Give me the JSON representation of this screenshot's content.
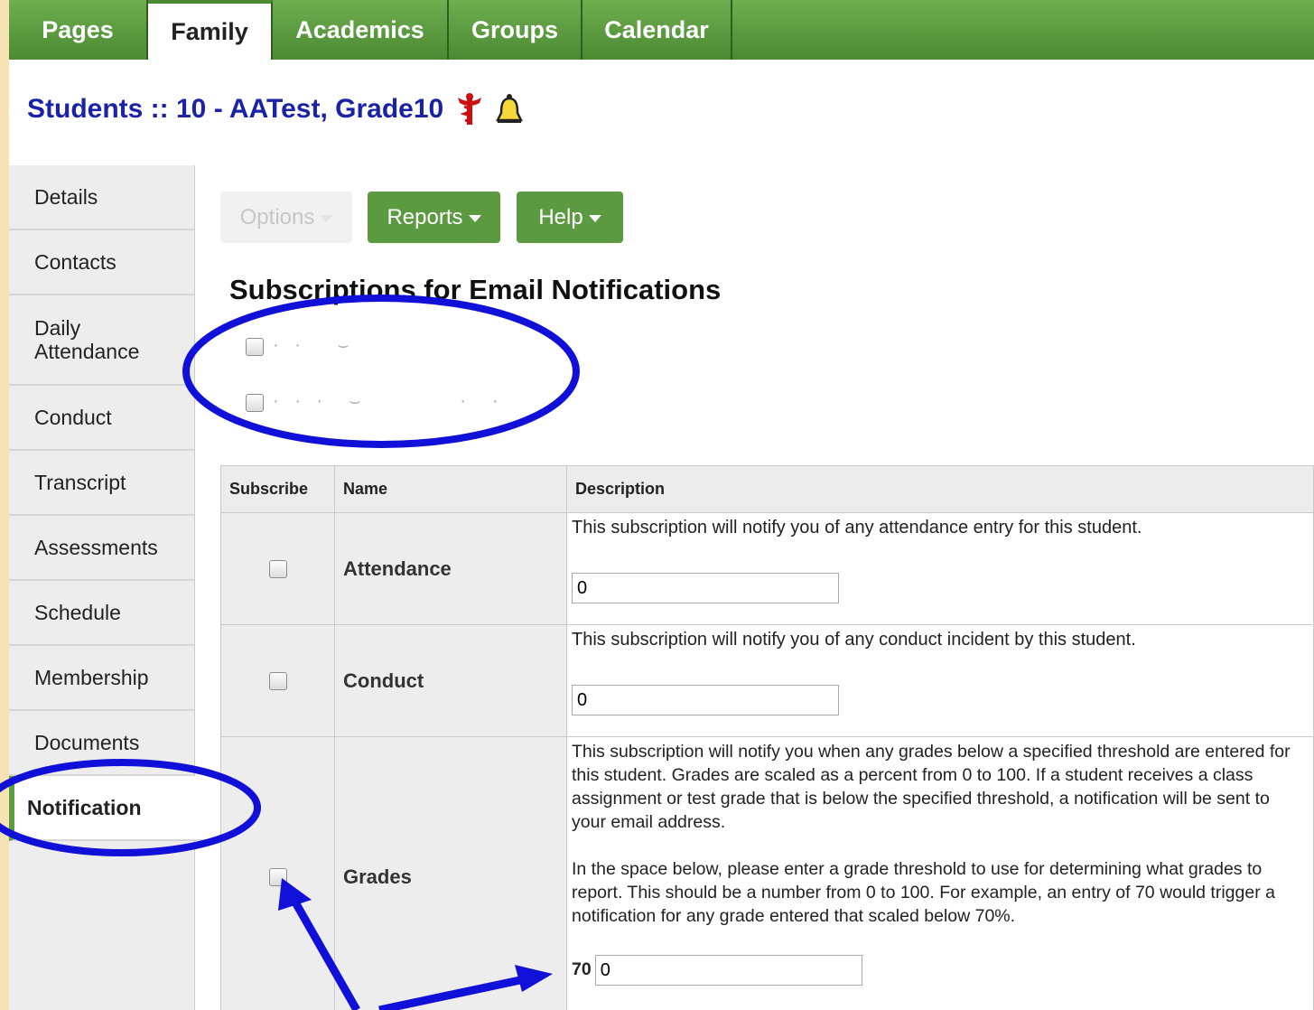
{
  "nav": {
    "tabs": [
      {
        "label": "Pages"
      },
      {
        "label": "Family"
      },
      {
        "label": "Academics"
      },
      {
        "label": "Groups"
      },
      {
        "label": "Calendar"
      }
    ]
  },
  "header": {
    "title": "Students :: 10 - AATest, Grade10"
  },
  "sidebar": {
    "items": [
      {
        "label": "Details"
      },
      {
        "label": "Contacts"
      },
      {
        "label": "Daily Attendance"
      },
      {
        "label": "Conduct"
      },
      {
        "label": "Transcript"
      },
      {
        "label": "Assessments"
      },
      {
        "label": "Schedule"
      },
      {
        "label": "Membership"
      },
      {
        "label": "Documents"
      },
      {
        "label": "Notification"
      }
    ]
  },
  "toolbar": {
    "options": "Options",
    "reports": "Reports",
    "help": "Help"
  },
  "section": {
    "title": "Subscriptions for Email Notifications"
  },
  "table": {
    "headers": {
      "subscribe": "Subscribe",
      "name": "Name",
      "description": "Description"
    },
    "rows": [
      {
        "name": "Attendance",
        "description": "This subscription will notify you of any attendance entry for this student.",
        "value": "0"
      },
      {
        "name": "Conduct",
        "description": "This subscription will notify you of any conduct incident by this student.",
        "value": "0"
      },
      {
        "name": "Grades",
        "description": "This subscription will notify you when any grades below a specified threshold are entered for this student. Grades are scaled as a percent from 0 to 100. If a student receives a class assignment or test grade that is below the specified threshold, a notification will be sent to your email address.",
        "description2": "In the space below, please enter a grade threshold to use for determining what grades to report. This should be a number from 0 to 100. For example, an entry of 70 would trigger a notification for any grade entered that scaled below 70%.",
        "threshold_label": "70",
        "value": "0"
      }
    ]
  },
  "colors": {
    "nav_green": "#5c9a42",
    "title_blue": "#1a23a8",
    "annotation_blue": "#1010d8",
    "background": "#f6e3b3"
  },
  "icons": [
    "medical-alert-icon",
    "bell-alert-icon",
    "dropdown-caret-icon"
  ]
}
